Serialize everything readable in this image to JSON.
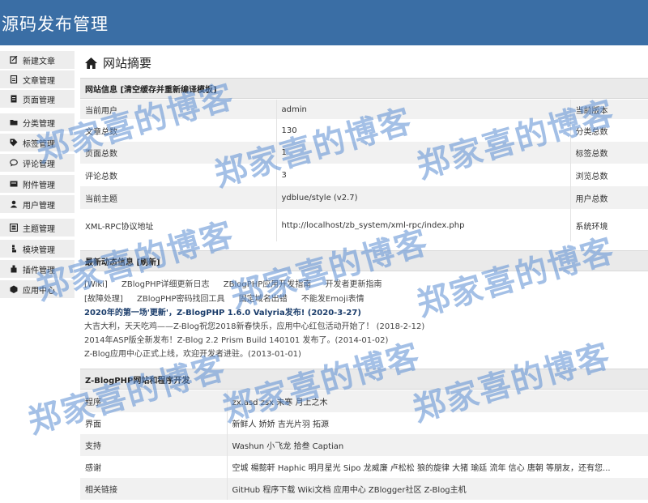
{
  "header": {
    "title": "源码发布管理"
  },
  "sidebar": {
    "items": [
      {
        "label": "新建文章",
        "icon": "edit-icon"
      },
      {
        "label": "文章管理",
        "icon": "document-icon"
      },
      {
        "label": "页面管理",
        "icon": "page-icon"
      },
      {
        "label": "分类管理",
        "icon": "folder-icon"
      },
      {
        "label": "标签管理",
        "icon": "tag-icon"
      },
      {
        "label": "评论管理",
        "icon": "comment-icon"
      },
      {
        "label": "附件管理",
        "icon": "attachment-icon"
      },
      {
        "label": "用户管理",
        "icon": "user-icon"
      },
      {
        "label": "主题管理",
        "icon": "theme-icon"
      },
      {
        "label": "模块管理",
        "icon": "module-icon"
      },
      {
        "label": "插件管理",
        "icon": "plugin-icon"
      },
      {
        "label": "应用中心",
        "icon": "app-center-icon"
      }
    ]
  },
  "main": {
    "page_title": "网站摘要",
    "site_info": {
      "heading": "网站信息 [清空缓存并重新编译模板]",
      "rows": [
        {
          "label": "当前用户",
          "value": "admin",
          "label2": "当前版本"
        },
        {
          "label": "文章总数",
          "value": "130",
          "label2": "分类总数"
        },
        {
          "label": "页面总数",
          "value": "1",
          "label2": "标签总数"
        },
        {
          "label": "评论总数",
          "value": "3",
          "label2": "浏览总数"
        },
        {
          "label": "当前主题",
          "value": "ydblue/style (v2.7)",
          "label2": "用户总数"
        },
        {
          "label": "XML-RPC协议地址",
          "value": "http://localhost/zb_system/xml-rpc/index.php",
          "label2": "系统环境"
        }
      ]
    },
    "news": {
      "heading": "最新动态信息 [刷新]",
      "line1": [
        "[Wiki]",
        "ZBlogPHP详细更新日志",
        "ZBlogPHP应用开发指南",
        "开发者更新指南"
      ],
      "line2": [
        "[故障处理]",
        "ZBlogPHP密码找回工具",
        "固定域名出错",
        "不能发Emoji表情"
      ],
      "headline": "2020年的第一场'更新'，Z-BlogPHP 1.6.0 Valyria发布! (2020-3-27)",
      "items": [
        "大吉大利，天天吃鸡——Z-Blog祝您2018新春快乐，应用中心红包活动开始了！ (2018-2-12)",
        "2014年ASP版全新发布！Z-Blog 2.2 Prism Build 140101 发布了。(2014-01-02)",
        "Z-Blog应用中心正式上线，欢迎开发者进驻。(2013-01-01)"
      ]
    },
    "dev": {
      "heading": "Z-BlogPHP网站和程序开发",
      "rows": [
        {
          "label": "程序",
          "value": "zx.asd zsx 未寒 月上之木"
        },
        {
          "label": "界面",
          "value": "新鲜人 娇娇 吉光片羽 拓源"
        },
        {
          "label": "支持",
          "value": "Washun 小飞龙 拾叁 Captian"
        },
        {
          "label": "感谢",
          "value": "空城 楊懿軒 Haphic 明月星光 Sipo 龙威廉 卢松松 狼的旋律 大猪 瑜廷 流年 信心 唐朝 等朋友，还有您..."
        },
        {
          "label": "相关链接",
          "value": "GitHub 程序下载  Wiki文档  应用中心  ZBlogger社区  Z-Blog主机"
        }
      ]
    }
  },
  "watermark": {
    "text": "郑家喜的博客",
    "color": "#5a8cd2"
  }
}
